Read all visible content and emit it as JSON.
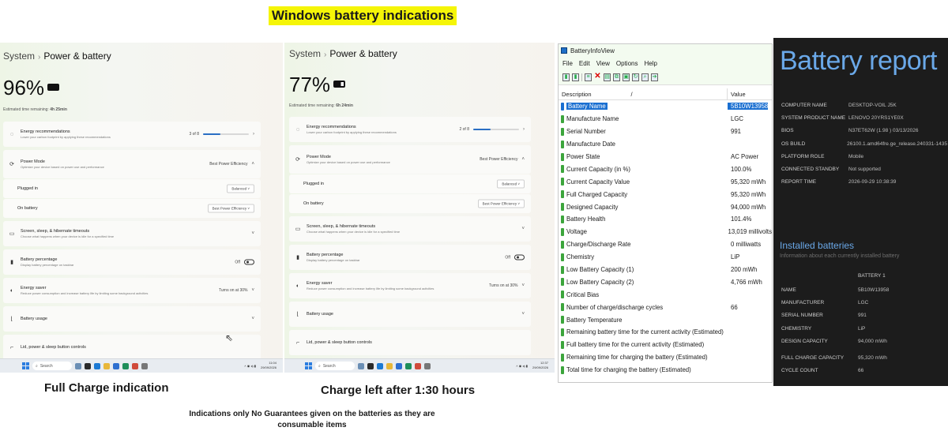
{
  "page": {
    "title": "Windows battery indications",
    "caption_left": "Full Charge indication",
    "caption_mid": "Charge left after 1:30 hours",
    "disclaimer": "Indications only No Guarantees given on the batteries as they are consumable items"
  },
  "panels": [
    {
      "breadcrumb_root": "System",
      "breadcrumb_sep": "›",
      "breadcrumb_current": "Power & battery",
      "percent": "96%",
      "battery_level": 0.96,
      "estimate_label": "Estimated time remaining:",
      "estimate_value": "4h 25min",
      "energy_title": "Energy recommendations",
      "energy_sub": "Lower your carbon footprint by applying these recommendations",
      "energy_count": "3 of 8",
      "power_mode_title": "Power Mode",
      "power_mode_sub": "Optimize your device based on power use and performance",
      "power_mode_value": "Best Power Efficiency",
      "plugged_in_label": "Plugged in",
      "plugged_in_value": "Balanced",
      "on_battery_label": "On battery",
      "on_battery_value": "Best Power Efficiency",
      "screen_title": "Screen, sleep, & hibernate timeouts",
      "screen_sub": "Choose what happens when your device is idle for a specified time",
      "batt_pct_title": "Battery percentage",
      "batt_pct_sub": "Display battery percentage on taskbar",
      "batt_pct_value": "Off",
      "saver_title": "Energy saver",
      "saver_sub": "Reduce power consumption and increase battery life by limiting some background activities",
      "saver_value": "Turns on at 30%",
      "usage_title": "Battery usage",
      "lid_title": "Lid, power & sleep button controls",
      "search_placeholder": "Search",
      "clock_time": "11:04",
      "clock_date": "29/09/2026"
    },
    {
      "breadcrumb_root": "System",
      "breadcrumb_sep": "›",
      "breadcrumb_current": "Power & battery",
      "percent": "77%",
      "battery_level": 0.77,
      "estimate_label": "Estimated time remaining:",
      "estimate_value": "6h 24min",
      "energy_title": "Energy recommendations",
      "energy_sub": "Lower your carbon footprint by applying these recommendations",
      "energy_count": "2 of 8",
      "power_mode_title": "Power Mode",
      "power_mode_sub": "Optimize your device based on power use and performance",
      "power_mode_value": "Best Power Efficiency",
      "plugged_in_label": "Plugged in",
      "plugged_in_value": "Balanced",
      "on_battery_label": "On battery",
      "on_battery_value": "Best Power Efficiency",
      "screen_title": "Screen, sleep, & hibernate timeouts",
      "screen_sub": "Choose what happens when your device is idle for a specified time",
      "batt_pct_title": "Battery percentage",
      "batt_pct_sub": "Display battery percentage on taskbar",
      "batt_pct_value": "Off",
      "saver_title": "Energy saver",
      "saver_sub": "Reduce power consumption and increase battery life by limiting some background activities",
      "saver_value": "Turns on at 30%",
      "usage_title": "Battery usage",
      "lid_title": "Lid, power & sleep button controls",
      "search_placeholder": "Search",
      "clock_time": "12:37",
      "clock_date": "29/09/2026"
    }
  ],
  "biv": {
    "title": "BatteryInfoView",
    "menu": [
      "File",
      "Edit",
      "View",
      "Options",
      "Help"
    ],
    "col_description": "Description",
    "col_sort": "/",
    "col_value": "Value",
    "rows": [
      {
        "d": "Battery Name",
        "v": "5B10W13958"
      },
      {
        "d": "Manufacture Name",
        "v": "LGC"
      },
      {
        "d": "Serial Number",
        "v": "991"
      },
      {
        "d": "Manufacture Date",
        "v": ""
      },
      {
        "d": "Power State",
        "v": "AC Power"
      },
      {
        "d": "Current Capacity (in %)",
        "v": "100.0%"
      },
      {
        "d": "Current Capacity Value",
        "v": "95,320 mWh"
      },
      {
        "d": "Full Charged Capacity",
        "v": "95,320 mWh"
      },
      {
        "d": "Designed Capacity",
        "v": "94,000 mWh"
      },
      {
        "d": "Battery Health",
        "v": "101.4%"
      },
      {
        "d": "Voltage",
        "v": "13,019 millivolts"
      },
      {
        "d": "Charge/Discharge Rate",
        "v": "0 milliwatts"
      },
      {
        "d": "Chemistry",
        "v": "LiP"
      },
      {
        "d": "Low Battery Capacity (1)",
        "v": "200 mWh"
      },
      {
        "d": "Low Battery Capacity (2)",
        "v": "4,766 mWh"
      },
      {
        "d": "Critical Bias",
        "v": ""
      },
      {
        "d": "Number of charge/discharge cycles",
        "v": "66"
      },
      {
        "d": "Battery Temperature",
        "v": ""
      },
      {
        "d": "Remaining battery time for the current activity (Estimated)",
        "v": ""
      },
      {
        "d": "Full battery time for the current activity (Estimated)",
        "v": ""
      },
      {
        "d": "Remaining time for charging the battery (Estimated)",
        "v": ""
      },
      {
        "d": "Total  time for charging the battery (Estimated)",
        "v": ""
      }
    ]
  },
  "report": {
    "title": "Battery report",
    "system": [
      {
        "k": "COMPUTER NAME",
        "v": "DESKTOP-VOIL J5K"
      },
      {
        "k": "SYSTEM PRODUCT NAME",
        "v": "LENOVO 20YRS1YE0X"
      },
      {
        "k": "BIOS",
        "v": "N37ET62W (1.98 ) 03/13/2026"
      },
      {
        "k": "OS BUILD",
        "v": "26100.1.amd64fre.ge_release.240331-1435"
      },
      {
        "k": "PLATFORM ROLE",
        "v": "Mobile"
      },
      {
        "k": "CONNECTED STANDBY",
        "v": "Not supported"
      },
      {
        "k": "REPORT TIME",
        "v": "2026-09-29  10:38:39"
      }
    ],
    "installed_title": "Installed batteries",
    "installed_sub": "Information about each currently installed battery",
    "battery_col": "BATTERY 1",
    "battery": [
      {
        "k": "NAME",
        "v": "5B10W13958"
      },
      {
        "k": "MANUFACTURER",
        "v": "LGC"
      },
      {
        "k": "SERIAL NUMBER",
        "v": "991"
      },
      {
        "k": "CHEMISTRY",
        "v": "LiP"
      },
      {
        "k": "DESIGN CAPACITY",
        "v": "94,000 mWh"
      },
      {
        "k": "FULL CHARGE CAPACITY",
        "v": "95,320 mWh"
      },
      {
        "k": "CYCLE COUNT",
        "v": "66"
      }
    ]
  },
  "colors": {
    "highlight": "#f5f507",
    "selection": "#1a6fd1",
    "report_bg": "#1c1c1c",
    "report_accent": "#6aa8e8",
    "gauge_green": "#3ca53c"
  }
}
